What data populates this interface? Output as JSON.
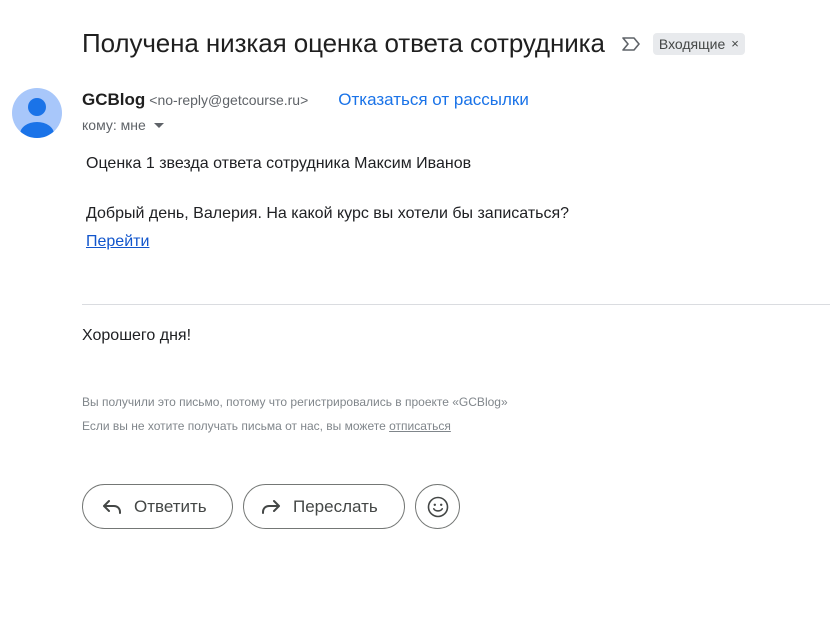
{
  "header": {
    "subject": "Получена низкая оценка ответа сотрудника",
    "label": "Входящие",
    "label_remove": "×"
  },
  "sender": {
    "name": "GCBlog",
    "email": "<no-reply@getcourse.ru>",
    "unsubscribe": "Отказаться от рассылки",
    "to": "кому: мне"
  },
  "body": {
    "line1": "Оценка 1 звезда ответа сотрудника Максим Иванов",
    "line2": "Добрый день, Валерия. На какой курс вы хотели бы записаться?",
    "link": "Перейти",
    "farewell": "Хорошего дня!"
  },
  "footer": {
    "notice": "Вы получили это письмо, потому что регистрировались в проекте «GCBlog»",
    "unsub_prefix": "Если вы не хотите получать письма от нас, вы можете ",
    "unsub_link": "отписаться"
  },
  "actions": {
    "reply": "Ответить",
    "forward": "Переслать"
  },
  "icons": {
    "importance": "importance-marker-icon",
    "avatar": "person-avatar-icon",
    "reply": "reply-arrow-icon",
    "forward": "forward-arrow-icon",
    "emoji": "emoji-smile-icon"
  },
  "colors": {
    "accent": "#1a73e8",
    "link": "#1155cc",
    "avatar_bg": "#a8c7fa",
    "avatar_fg": "#1a73e8"
  }
}
